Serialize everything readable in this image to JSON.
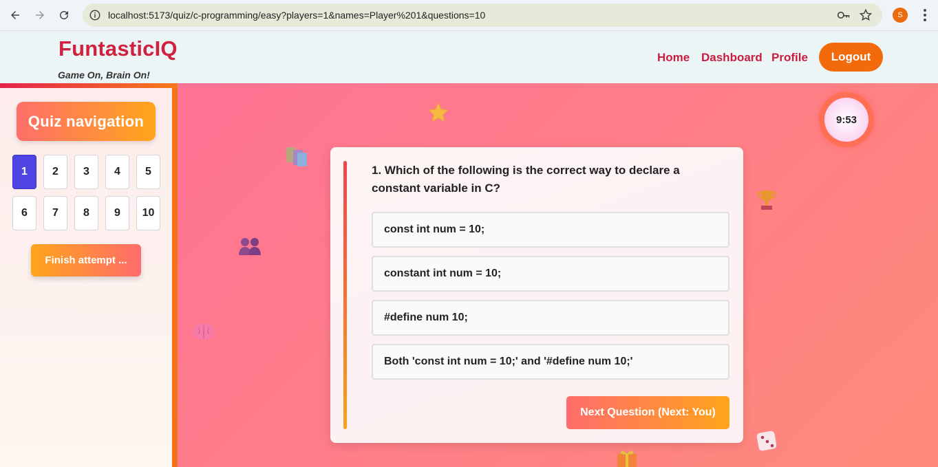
{
  "browser": {
    "url": "localhost:5173/quiz/c-programming/easy?players=1&names=Player%201&questions=10",
    "profile_initial": "S"
  },
  "header": {
    "brand": "FuntasticIQ",
    "tagline": "Game On, Brain On!",
    "nav": {
      "home": "Home",
      "dashboard": "Dashboard",
      "profile": "Profile",
      "logout": "Logout"
    }
  },
  "sidebar": {
    "title": "Quiz navigation",
    "questions": [
      "1",
      "2",
      "3",
      "4",
      "5",
      "6",
      "7",
      "8",
      "9",
      "10"
    ],
    "active_question": "1",
    "finish_label": "Finish attempt ..."
  },
  "timer": {
    "value": "9:53"
  },
  "question": {
    "text": "1. Which of the following is the correct way to declare a constant variable in C?",
    "options": [
      "const int num = 10;",
      "constant int num = 10;",
      "#define num 10;",
      "Both 'const int num = 10;' and '#define num 10;'"
    ],
    "next_label": "Next Question (Next: You)"
  },
  "colors": {
    "brand": "#d1213e",
    "logout": "#f36a0c",
    "active_question": "#4e45e3"
  },
  "decorations": [
    "star-icon",
    "books-icon",
    "people-icon",
    "brain-icon",
    "trophy-icon",
    "dice-icon",
    "gift-icon"
  ]
}
